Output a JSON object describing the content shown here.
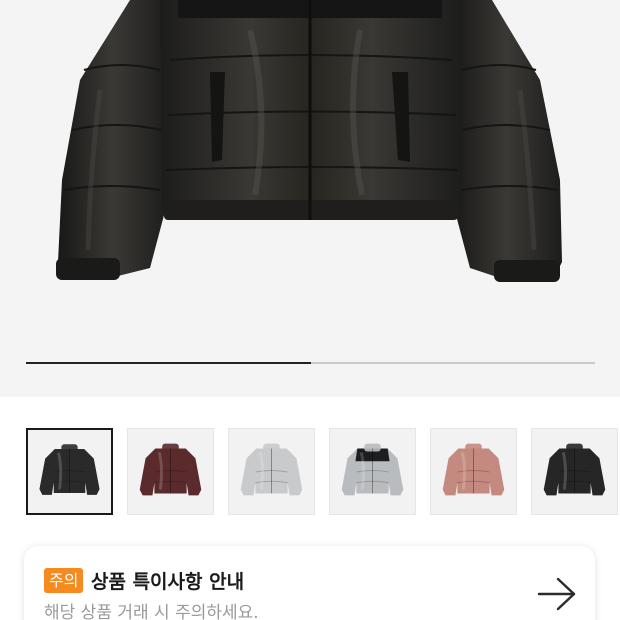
{
  "gallery": {
    "current_image": 1,
    "total_images": 2,
    "progress_fraction": 0.5
  },
  "thumbnails": [
    {
      "name": "black-glossy-cropped",
      "color": "#2a2a2a",
      "selected": true
    },
    {
      "name": "burgundy",
      "color": "#5a2a2c",
      "selected": false
    },
    {
      "name": "silver",
      "color": "#c8cacc",
      "selected": false
    },
    {
      "name": "silver-black-yoke",
      "color": "#b9bcbf",
      "selected": false
    },
    {
      "name": "rose-pink",
      "color": "#c48a80",
      "selected": false
    },
    {
      "name": "black-matte",
      "color": "#262626",
      "selected": false
    }
  ],
  "notice": {
    "badge": "주의",
    "title": "상품 특이사항 안내",
    "subtitle": "해당 상품 거래 시 주의하세요."
  },
  "colors": {
    "badge_bg": "#f58a1f",
    "hero_bg": "#f4f4f4",
    "progress_active": "#222222",
    "progress_track": "#c9c9c9"
  }
}
